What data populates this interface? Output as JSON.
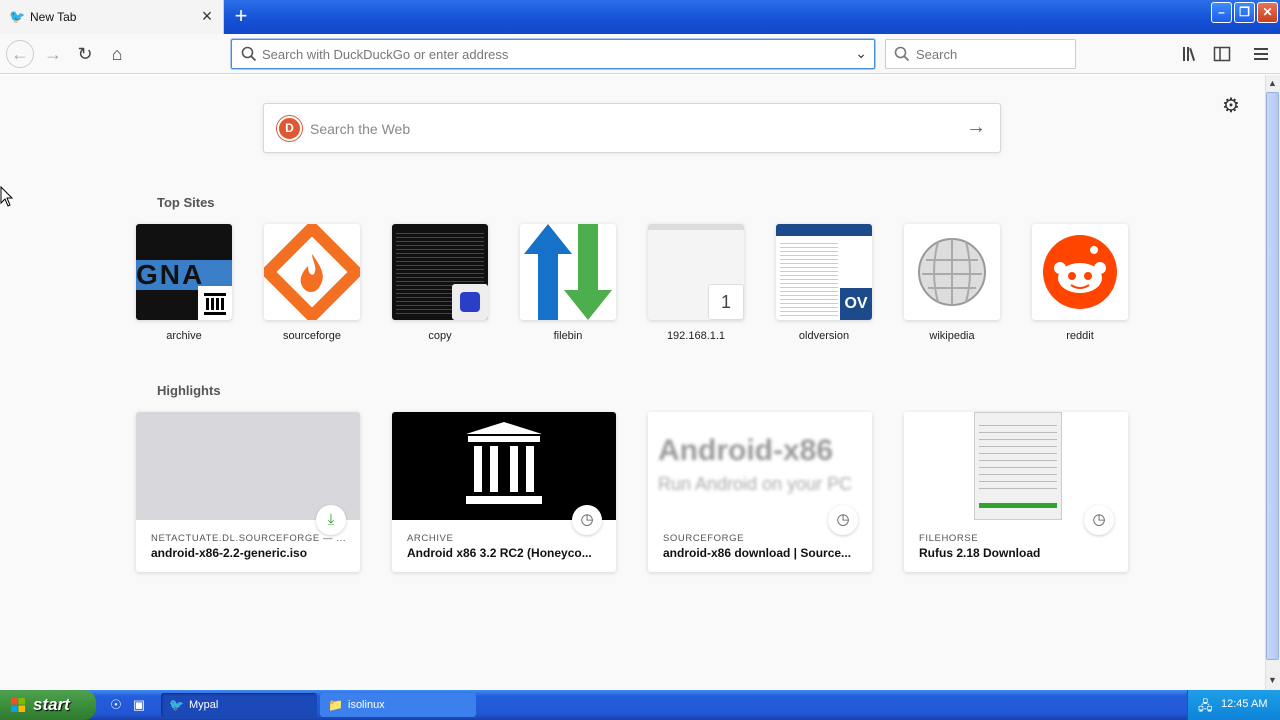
{
  "tab": {
    "title": "New Tab"
  },
  "navbar": {
    "url_placeholder": "Search with DuckDuckGo or enter address",
    "search_placeholder": "Search"
  },
  "content": {
    "web_search_placeholder": "Search the Web",
    "top_sites_title": "Top Sites",
    "top_sites": [
      {
        "label": "archive"
      },
      {
        "label": "sourceforge"
      },
      {
        "label": "copy"
      },
      {
        "label": "filebin"
      },
      {
        "label": "192.168.1.1",
        "badge": "1"
      },
      {
        "label": "oldversion",
        "badge": "OV"
      },
      {
        "label": "wikipedia"
      },
      {
        "label": "reddit"
      }
    ],
    "highlights_title": "Highlights",
    "highlights": [
      {
        "source": "NETACTUATE.DL.SOURCEFORGE — ...",
        "title": "android-x86-2.2-generic.iso",
        "badge": "download-icon"
      },
      {
        "source": "ARCHIVE",
        "title": "Android x86 3.2 RC2 (Honeyco...",
        "badge": "clock-icon"
      },
      {
        "source": "SOURCEFORGE",
        "title": "android-x86 download | Source...",
        "badge": "clock-icon",
        "thumb_text_1": "Android-x86",
        "thumb_text_2": "Run Android on your PC"
      },
      {
        "source": "FILEHORSE",
        "title": "Rufus 2.18 Download",
        "badge": "clock-icon"
      }
    ]
  },
  "taskbar": {
    "start_label": "start",
    "tasks": [
      {
        "label": "Mypal"
      },
      {
        "label": "isolinux"
      }
    ],
    "clock": "12:45 AM"
  },
  "colors": {
    "titlebar": "#1450d6",
    "reddit": "#ff4500",
    "duckduckgo": "#de5833",
    "start_green": "#3c8f3c"
  }
}
